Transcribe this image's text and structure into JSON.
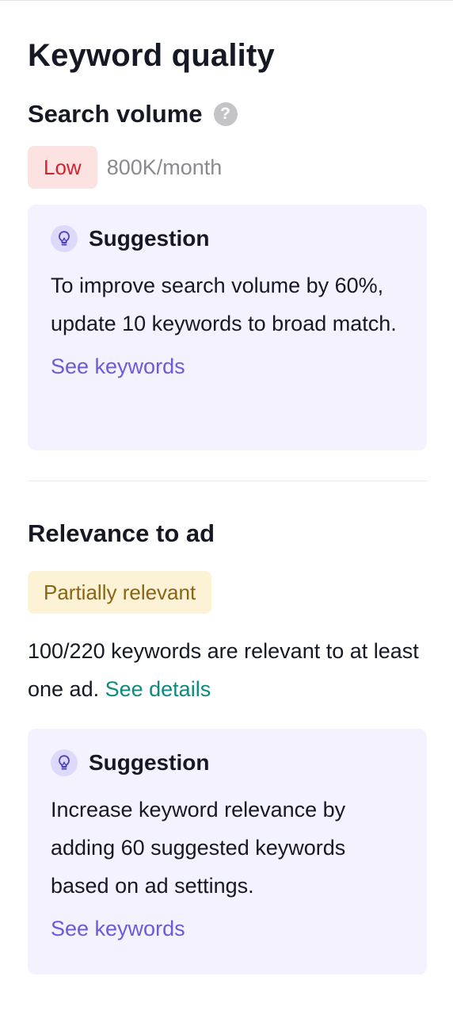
{
  "panel": {
    "title": "Keyword quality"
  },
  "search_volume": {
    "heading": "Search volume",
    "help_icon_glyph": "?",
    "badge": "Low",
    "volume": "800K/month",
    "suggestion": {
      "icon": "lightbulb-icon",
      "title": "Suggestion",
      "body": "To improve search volume by 60%, update 10 keywords to broad match.",
      "link": "See keywords"
    }
  },
  "relevance": {
    "heading": "Relevance to ad",
    "badge": "Partially relevant",
    "text": "100/220 keywords are relevant to at least one ad.",
    "details_link": "See details",
    "suggestion": {
      "icon": "lightbulb-icon",
      "title": "Suggestion",
      "body": "Increase keyword relevance by adding 60 suggested keywords based on ad settings.",
      "link": "See keywords"
    }
  },
  "colors": {
    "low_badge_bg": "#fde2e2",
    "low_badge_text": "#d0242f",
    "partial_badge_bg": "#fcf2d6",
    "partial_badge_text": "#8a6414",
    "suggestion_card_bg": "#f3f2fe",
    "link_purple": "#6b5bd6",
    "link_teal": "#0d8a7d"
  }
}
